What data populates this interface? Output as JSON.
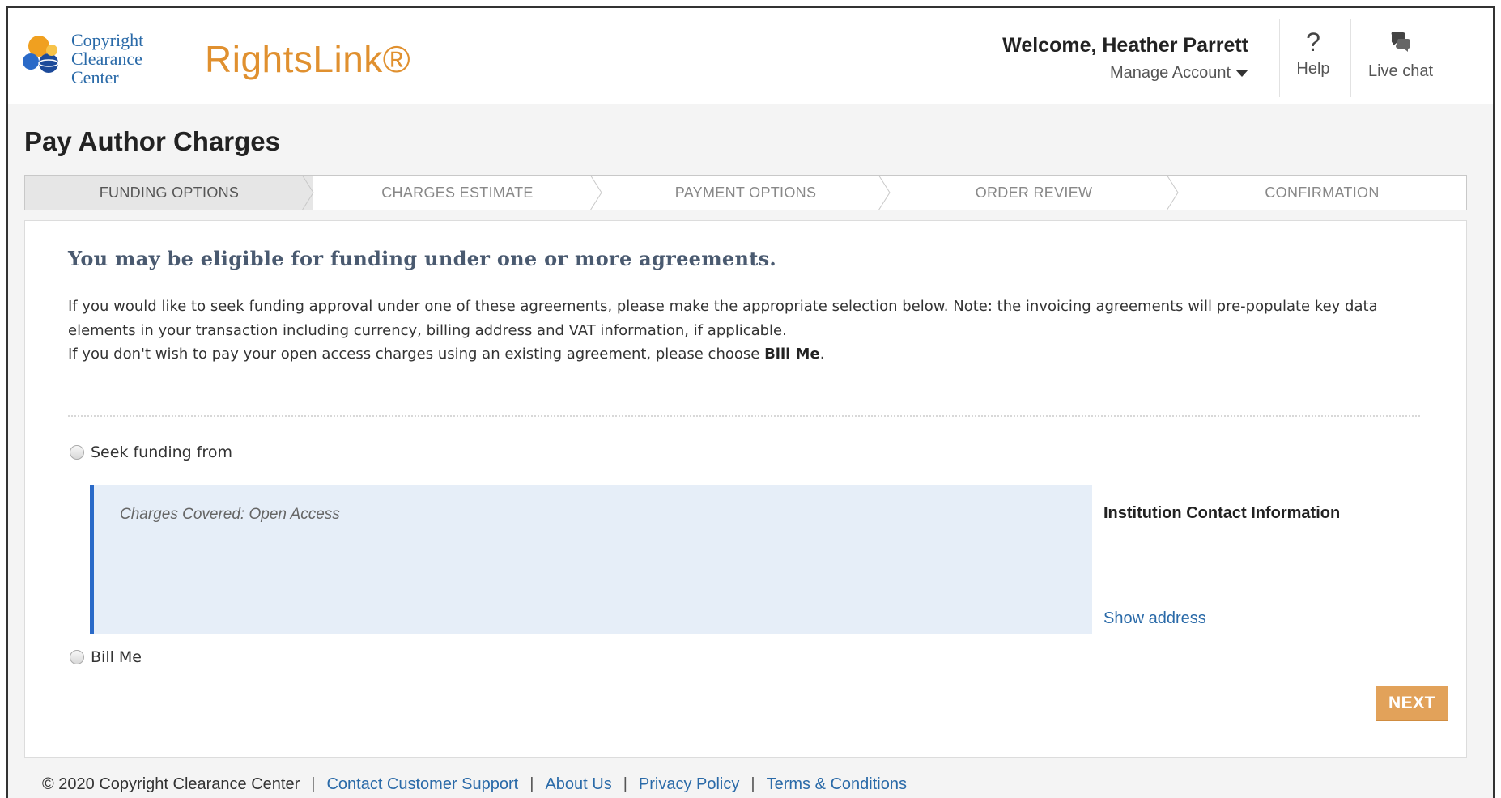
{
  "header": {
    "logo_lines": [
      "Copyright",
      "Clearance",
      "Center"
    ],
    "brand": "RightsLink®",
    "welcome": "Welcome, Heather Parrett",
    "manage_account": "Manage Account",
    "help_label": "Help",
    "help_symbol": "?",
    "live_chat_label": "Live chat"
  },
  "page_title": "Pay Author Charges",
  "steps": [
    {
      "label": "FUNDING OPTIONS",
      "active": true
    },
    {
      "label": "CHARGES ESTIMATE",
      "active": false
    },
    {
      "label": "PAYMENT OPTIONS",
      "active": false
    },
    {
      "label": "ORDER REVIEW",
      "active": false
    },
    {
      "label": "CONFIRMATION",
      "active": false
    }
  ],
  "main": {
    "heading": "You may be eligible for funding under one or more agreements.",
    "para1": "If you would like to seek funding approval under one of these agreements, please make the appropriate selection below. Note: the invoicing agreements will pre-populate key data elements in your transaction including currency, billing address and VAT information, if applicable.",
    "para2_prefix": "If you don't wish to pay your open access charges using an existing agreement, please choose ",
    "para2_bold": "Bill Me",
    "para2_suffix": ".",
    "option_seek": "Seek funding from",
    "charges_covered": "Charges Covered: Open Access",
    "institution_title": "Institution Contact Information",
    "show_address": "Show address",
    "option_bill": "Bill Me",
    "next_label": "NEXT"
  },
  "footer": {
    "copyright": "© 2020 Copyright Clearance Center",
    "links": [
      "Contact Customer Support",
      "About Us",
      "Privacy Policy",
      "Terms & Conditions"
    ]
  },
  "colors": {
    "brand_orange": "#e0902f",
    "link_blue": "#2a6aa8",
    "next_button": "#e2a25a",
    "charges_box": "#e6eef8",
    "charges_border": "#2a6ac8"
  }
}
